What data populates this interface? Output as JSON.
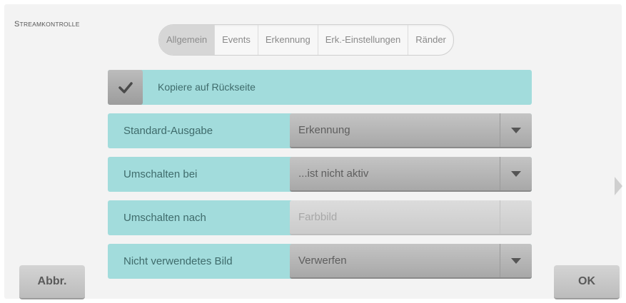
{
  "title": "Streamkontrolle",
  "tabs": [
    {
      "label": "Allgemein"
    },
    {
      "label": "Events"
    },
    {
      "label": "Erkennung"
    },
    {
      "label": "Erk.-Einstellungen"
    },
    {
      "label": "Ränder"
    }
  ],
  "copy_back": {
    "label": "Kopiere auf Rückseite",
    "checked": true
  },
  "rows": [
    {
      "label": "Standard-Ausgabe",
      "value": "Erkennung",
      "enabled": true
    },
    {
      "label": "Umschalten bei",
      "value": "...ist nicht aktiv",
      "enabled": true
    },
    {
      "label": "Umschalten nach",
      "value": "Farbbild",
      "enabled": false
    },
    {
      "label": "Nicht verwendetes Bild",
      "value": "Verwerfen",
      "enabled": true
    }
  ],
  "buttons": {
    "cancel": "Abbr.",
    "ok": "OK"
  },
  "icons": {
    "check": "check-icon",
    "dropdown": "chevron-down-icon",
    "next": "chevron-right-icon"
  },
  "colors": {
    "accent": "#a2dcdc",
    "control": "#b4b4b4"
  }
}
